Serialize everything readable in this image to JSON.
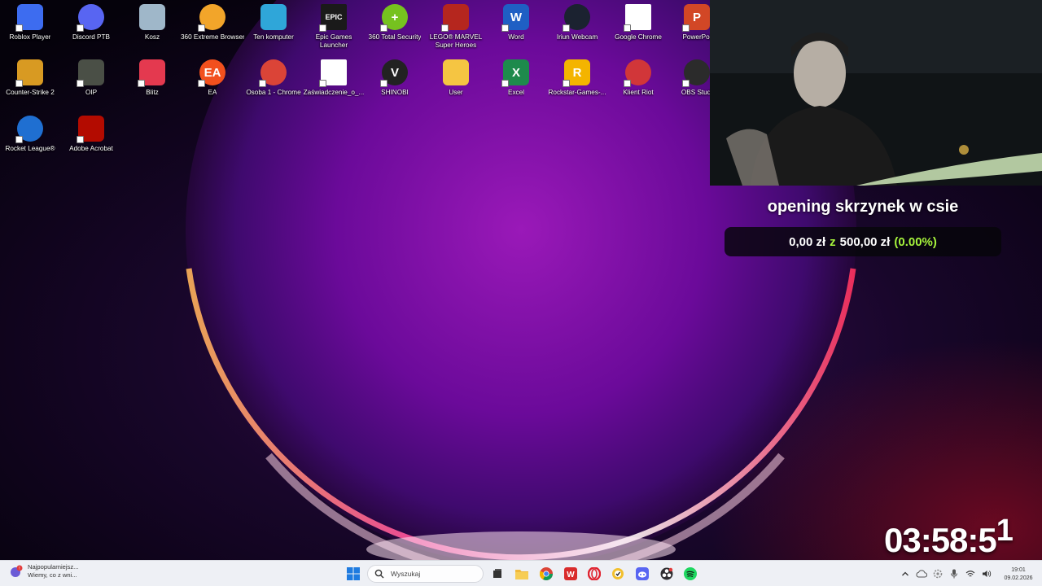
{
  "desktop": {
    "icons": [
      {
        "label": "Roblox Player",
        "icon": "roblox-icon",
        "color": "#3d6cf0"
      },
      {
        "label": "Discord PTB",
        "icon": "discord-icon",
        "color": "#5865f2"
      },
      {
        "label": "Kosz",
        "icon": "recycle-bin-icon",
        "color": "#9fb7c9"
      },
      {
        "label": "360 Extreme Browser",
        "icon": "360-browser-icon",
        "color": "#f2a52a"
      },
      {
        "label": "Ten komputer",
        "icon": "computer-icon",
        "color": "#2fa6d9"
      },
      {
        "label": "Epic Games Launcher",
        "icon": "epic-games-icon",
        "color": "#1a1a1a",
        "glyph": "EPIC"
      },
      {
        "label": "360 Total Security",
        "icon": "360-security-icon",
        "color": "#76c21f",
        "glyph": "+"
      },
      {
        "label": "LEGO® MARVEL Super Heroes",
        "icon": "lego-marvel-icon",
        "color": "#b5261e"
      },
      {
        "label": "Word",
        "icon": "word-icon",
        "color": "#1f5fc4",
        "glyph": "W"
      },
      {
        "label": "Iriun Webcam",
        "icon": "iriun-webcam-icon",
        "color": "#1b2230"
      },
      {
        "label": "Google Chrome",
        "icon": "file-icon",
        "color": "#ffffff"
      },
      {
        "label": "PowerPoi",
        "icon": "powerpoint-icon",
        "color": "#d24726",
        "glyph": "P"
      },
      {
        "label": "Counter-Strike 2",
        "icon": "counter-strike-icon",
        "color": "#d89a22"
      },
      {
        "label": "OIP",
        "icon": "image-icon",
        "color": "#4a4f46"
      },
      {
        "label": "Blitz",
        "icon": "blitz-icon",
        "color": "#e4394f"
      },
      {
        "label": "EA",
        "icon": "ea-icon",
        "color": "#f2501d",
        "glyph": "EA"
      },
      {
        "label": "Osoba 1 - Chrome",
        "icon": "chrome-icon",
        "color": "#db4437"
      },
      {
        "label": "Zaświadczenie_o_...",
        "icon": "pdf-document-icon",
        "color": "#ffffff"
      },
      {
        "label": "SHINOBI",
        "icon": "shinobi-icon",
        "color": "#222222",
        "glyph": "V"
      },
      {
        "label": "User",
        "icon": "folder-icon",
        "color": "#f5c542"
      },
      {
        "label": "Excel",
        "icon": "excel-icon",
        "color": "#1e8a4c",
        "glyph": "X"
      },
      {
        "label": "Rockstar-Games-...",
        "icon": "rockstar-icon",
        "color": "#f4b400",
        "glyph": "R"
      },
      {
        "label": "Klient Riot",
        "icon": "riot-icon",
        "color": "#d13639"
      },
      {
        "label": "OBS Studi",
        "icon": "obs-icon",
        "color": "#2b2b2b"
      },
      {
        "label": "Rocket League®",
        "icon": "rocket-league-icon",
        "color": "#1f6fd1"
      },
      {
        "label": "Adobe Acrobat",
        "icon": "acrobat-icon",
        "color": "#b30b00"
      }
    ]
  },
  "overlay": {
    "goal_title": "opening skrzynek w csie",
    "goal_current": "0,00 zł",
    "goal_sep": "z",
    "goal_target": "500,00 zł",
    "goal_percent": "(0.00%)",
    "goal_fraction": 0.0,
    "timer_main": "03:58:5",
    "timer_last": "1"
  },
  "taskbar": {
    "news_line1": "Najpopularniejsz...",
    "news_line2": "Wiemy, co z wni...",
    "search_placeholder": "Wyszukaj",
    "pinned": [
      "windows-start-icon",
      "task-view-icon",
      "file-explorer-icon",
      "chrome-icon",
      "wps-office-icon",
      "opera-icon",
      "norton-icon",
      "discord-icon",
      "obs-icon",
      "spotify-icon"
    ],
    "clock_time": "19:01",
    "clock_date": "09.02.2026"
  }
}
